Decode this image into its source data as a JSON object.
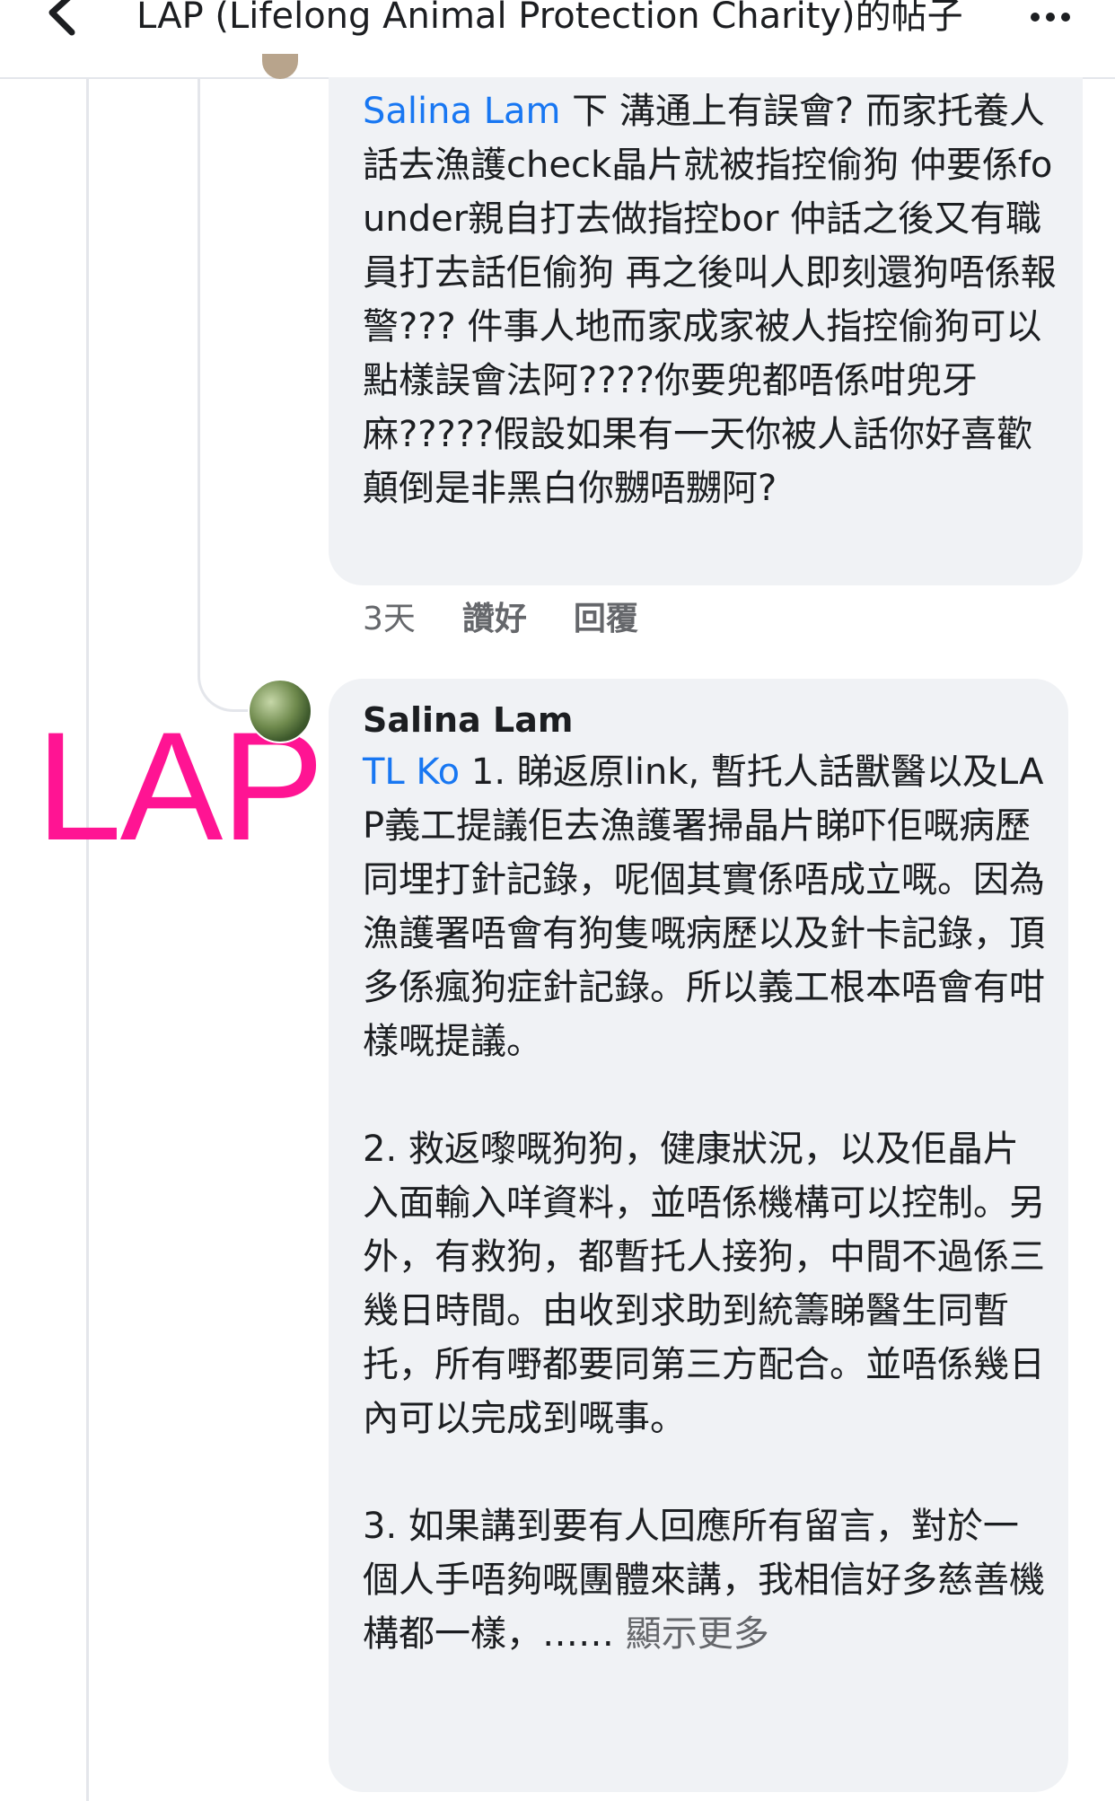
{
  "header": {
    "title": "LAP (Lifelong Animal Protection Charity)的帖子",
    "back_icon": "chevron-left-icon",
    "more_icon": "more-icon"
  },
  "watermark": {
    "text": "LAP",
    "color": "#ff1493"
  },
  "comments": [
    {
      "mention": "Salina Lam",
      "body": " 下 溝通上有誤會? 而家托養人話去漁護check晶片就被指控偷狗 仲要係founder親自打去做指控bor 仲話之後又有職員打去話佢偷狗 再之後叫人即刻還狗唔係報警??? 件事人地而家成家被人指控偷狗可以點樣誤會法阿????你要兜都唔係咁兜牙麻?????假設如果有一天你被人話你好喜歡顛倒是非黑白你嬲唔嬲阿?",
      "time": "3天",
      "like_label": "讚好",
      "reply_label": "回覆"
    },
    {
      "author": "Salina Lam",
      "mention": "TL Ko",
      "body": " 1. 睇返原link, 暫托人話獸醫以及LA P義工提議佢去漁護署掃晶片睇吓佢嘅病歷同埋打針記錄，呢個其實係唔成立嘅。因為漁護署唔會有狗隻嘅病歷以及針卡記錄，頂多係瘋狗症針記錄。所以義工根本唔會有咁樣嘅提議。\n\n2. 救返嚟嘅狗狗，健康狀況，以及佢晶片入面輸入咩資料，並唔係機構可以控制。另外，有救狗，都暫托人接狗，中間不過係三幾日時間。由收到求助到統籌睇醫生同暫托，所有嘢都要同第三方配合。並唔係幾日內可以完成到嘅事。\n\n3. 如果講到要有人回應所有留言，對於一個人手唔夠嘅團體來講，我相信好多慈善機構都一樣，……",
      "see_more": "顯示更多"
    }
  ],
  "colors": {
    "bubble": "#f0f2f5",
    "mention": "#1877f2",
    "meta": "#65676b"
  }
}
